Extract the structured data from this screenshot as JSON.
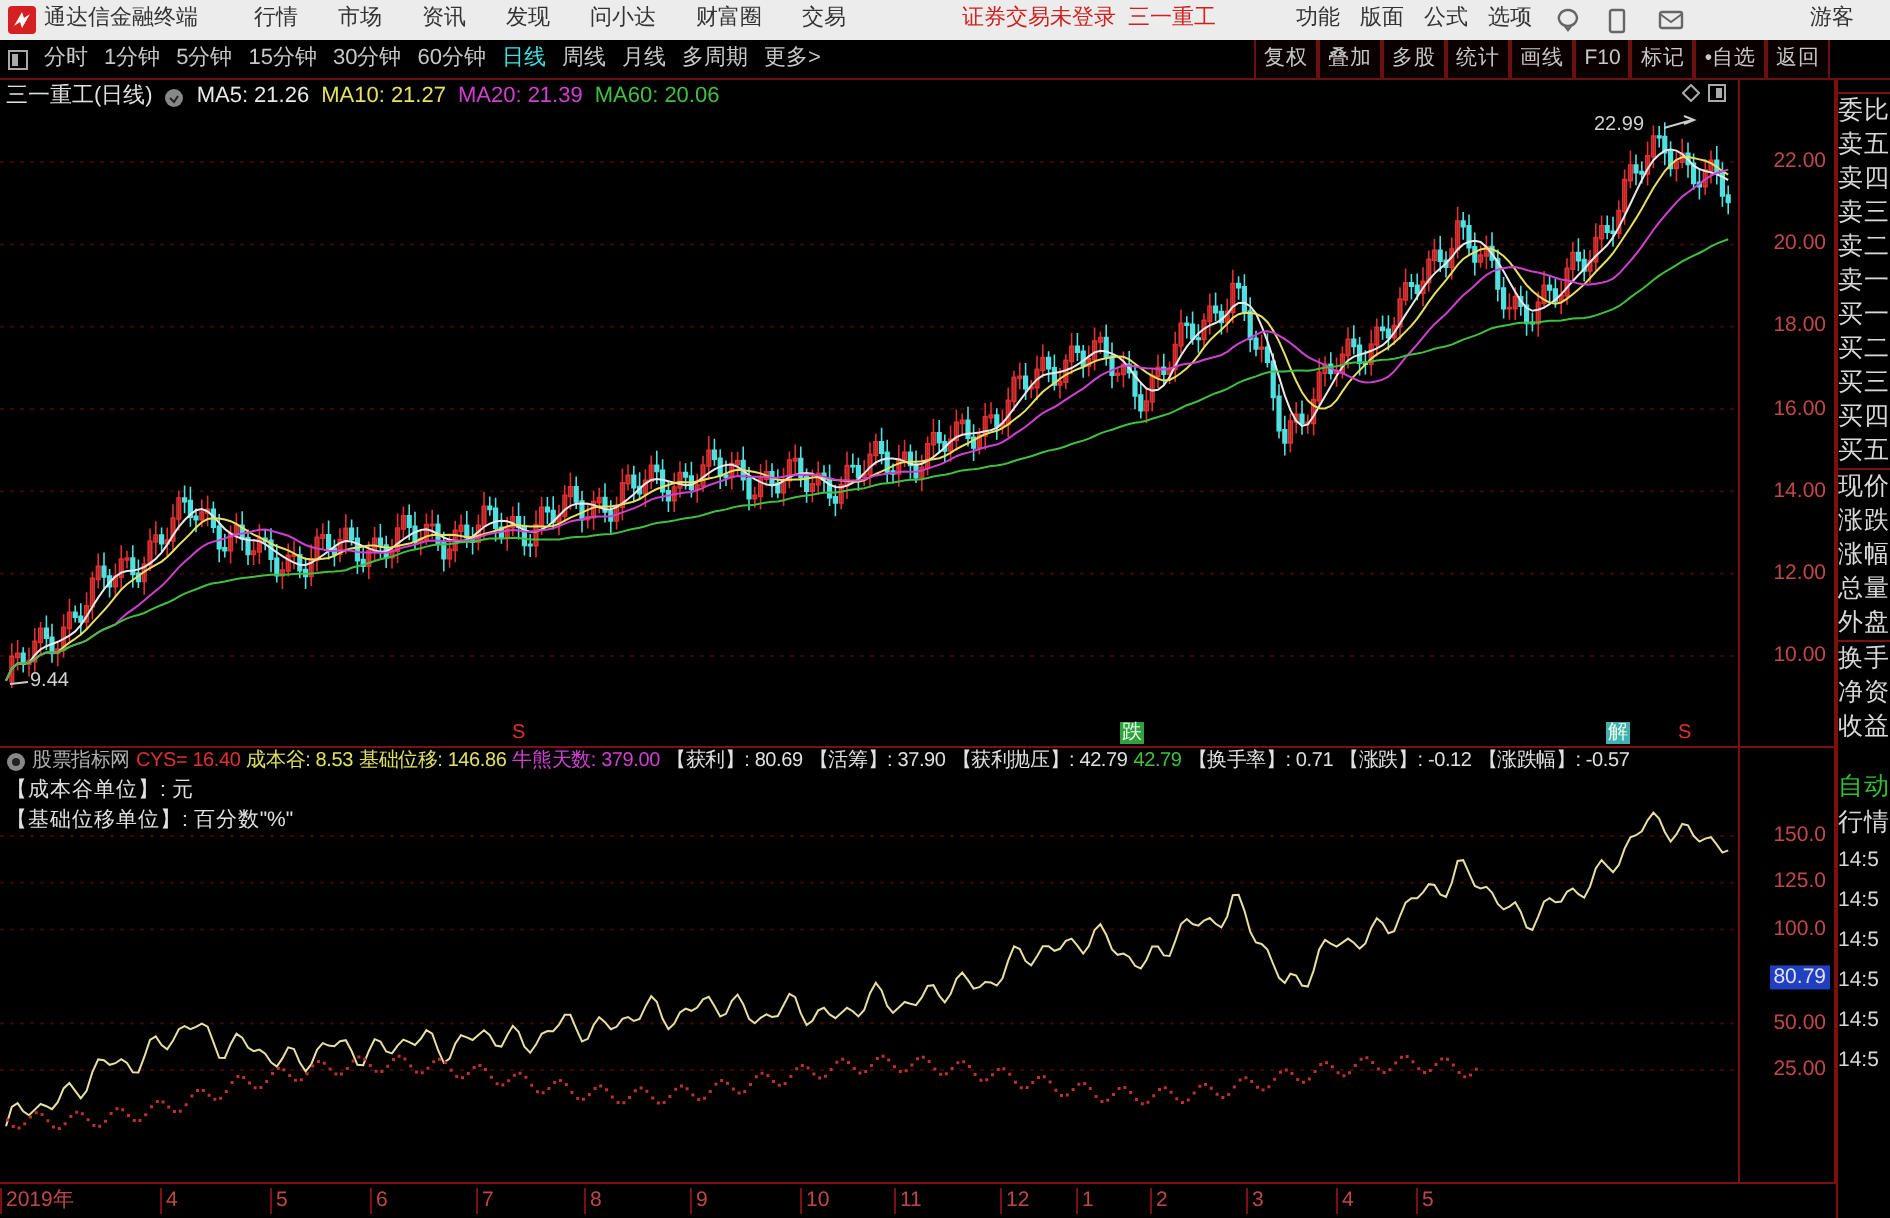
{
  "title_bar": {
    "app_title": "通达信金融终端",
    "menu": [
      "行情",
      "市场",
      "资讯",
      "发现",
      "问小达",
      "财富圈",
      "交易"
    ],
    "notice": "证券交易未登录",
    "stock_name": "三一重工",
    "tools": [
      "功能",
      "版面",
      "公式",
      "选项"
    ],
    "user": "游客"
  },
  "period_tabs": [
    {
      "label": "分时",
      "selected": false
    },
    {
      "label": "1分钟",
      "selected": false
    },
    {
      "label": "5分钟",
      "selected": false
    },
    {
      "label": "15分钟",
      "selected": false
    },
    {
      "label": "30分钟",
      "selected": false
    },
    {
      "label": "60分钟",
      "selected": false
    },
    {
      "label": "日线",
      "selected": true
    },
    {
      "label": "周线",
      "selected": false
    },
    {
      "label": "月线",
      "selected": false
    },
    {
      "label": "多周期",
      "selected": false
    },
    {
      "label": "更多>",
      "selected": false
    }
  ],
  "toolbar_buttons": [
    "复权",
    "叠加",
    "多股",
    "统计",
    "画线",
    "F10",
    "标记",
    "•自选",
    "返回"
  ],
  "main_chart": {
    "title": "三一重工(日线)",
    "ma": [
      {
        "label": "MA5: 21.26",
        "color": "#e8e8e8"
      },
      {
        "label": "MA10: 21.27",
        "color": "#e8e060"
      },
      {
        "label": "MA20: 21.39",
        "color": "#d040d0"
      },
      {
        "label": "MA60: 20.06",
        "color": "#40c040"
      }
    ],
    "high_label": "22.99",
    "low_label": "9.44",
    "yticks": [
      "22.00",
      "20.00",
      "18.00",
      "16.00",
      "14.00",
      "12.00",
      "10.00"
    ],
    "signals": [
      {
        "label": "S",
        "kind": "letter",
        "color": "#e03030"
      },
      {
        "label": "跌",
        "kind": "tag",
        "color": "#30a040"
      },
      {
        "label": "解",
        "kind": "tag",
        "color": "#40b0b0"
      },
      {
        "label": "S",
        "kind": "letter",
        "color": "#e03030"
      }
    ]
  },
  "indicator": {
    "name": "股票指标网",
    "values": [
      {
        "label": "CYS= 16.40",
        "color": "#e03030"
      },
      {
        "label": "成本谷: 8.53",
        "color": "#e0e060"
      },
      {
        "label": "基础位移: 146.86",
        "color": "#e0e060"
      },
      {
        "label": "牛熊天数: 379.00",
        "color": "#d040d0"
      },
      {
        "label": "【获利】: 80.69",
        "color": "#e0e0e0"
      },
      {
        "label": "【活筹】: 37.90",
        "color": "#e0e0e0"
      },
      {
        "label": "【获利抛压】: 42.79",
        "color": "#e0e0e0"
      },
      {
        "label": "42.79",
        "color": "#40c040"
      },
      {
        "label": "【换手率】: 0.71",
        "color": "#e0e0e0"
      },
      {
        "label": "【涨跌】: -0.12",
        "color": "#e0e0e0"
      },
      {
        "label": "【涨跌幅】: -0.57",
        "color": "#e0e0e0"
      }
    ],
    "notes": [
      "【成本谷单位】: 元",
      "【基础位移单位】: 百分数\"%\""
    ],
    "yticks": [
      "150.0",
      "125.0",
      "100.0",
      "50.00",
      "25.00"
    ],
    "current": "80.79"
  },
  "x_axis": [
    "2019年",
    "4",
    "5",
    "6",
    "7",
    "8",
    "9",
    "10",
    "11",
    "12",
    "1",
    "2",
    "3",
    "4",
    "5"
  ],
  "side_panel": {
    "quote_labels": [
      "委比",
      "卖五",
      "卖四",
      "卖三",
      "卖二",
      "卖一",
      "买一",
      "买二",
      "买三",
      "买四",
      "买五",
      "现价",
      "涨跌",
      "涨幅",
      "总量",
      "外盘",
      "换手",
      "净资",
      "收益"
    ],
    "mode_tabs": [
      "自动",
      "行情"
    ],
    "times": [
      "14:5",
      "14:5",
      "14:5",
      "14:5",
      "14:5",
      "14:5"
    ]
  }
}
